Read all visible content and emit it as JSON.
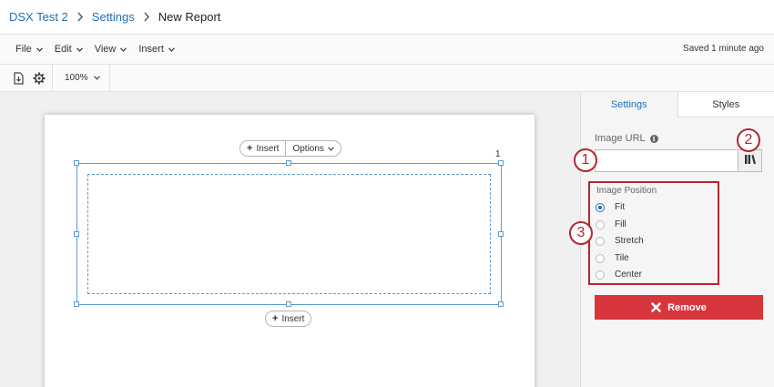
{
  "breadcrumb": {
    "items": [
      "DSX Test 2",
      "Settings"
    ],
    "current": "New Report"
  },
  "menubar": {
    "items": [
      "File",
      "Edit",
      "View",
      "Insert"
    ],
    "saved_status": "Saved 1 minute ago"
  },
  "toolbar": {
    "icons": [
      "export-icon",
      "gear-icon"
    ],
    "zoom": "100%"
  },
  "canvas": {
    "page_number": "1",
    "top_insert": "Insert",
    "options": "Options",
    "bottom_insert": "Insert"
  },
  "panel": {
    "tabs": [
      {
        "label": "Settings",
        "active": true
      },
      {
        "label": "Styles",
        "active": false
      }
    ],
    "image_url_label": "Image URL",
    "image_url_value": "",
    "image_position": {
      "title": "Image Position",
      "options": [
        "Fit",
        "Fill",
        "Stretch",
        "Tile",
        "Center"
      ],
      "selected": "Fit"
    },
    "remove_label": "Remove"
  },
  "callouts": [
    "1",
    "2",
    "3"
  ],
  "colors": {
    "accent": "#1f6fb5",
    "callout": "#b5262e",
    "remove": "#d8363d"
  }
}
